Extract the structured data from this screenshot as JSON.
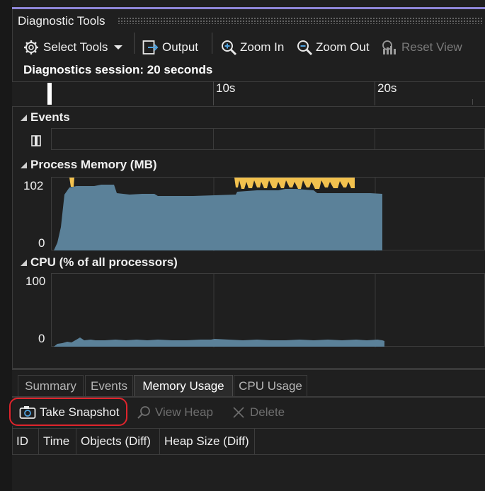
{
  "window": {
    "title": "Diagnostic Tools"
  },
  "toolbar": {
    "select_tools": "Select Tools",
    "output": "Output",
    "zoom_in": "Zoom In",
    "zoom_out": "Zoom Out",
    "reset_view": "Reset View"
  },
  "session": {
    "text": "Diagnostics session: 20 seconds"
  },
  "ruler": {
    "ticks": [
      "10s",
      "20s"
    ]
  },
  "sections": {
    "events": "Events",
    "memory": "Process Memory (MB)",
    "cpu": "CPU (% of all processors)"
  },
  "memory_chart": {
    "y_max_label": "102",
    "y_min_label": "0",
    "fill_color": "#5b8199",
    "gc_color": "#f2c14e"
  },
  "cpu_chart": {
    "y_max_label": "100",
    "y_min_label": "0",
    "fill_color": "#5b8199"
  },
  "tabs": [
    "Summary",
    "Events",
    "Memory Usage",
    "CPU Usage"
  ],
  "active_tab": "Memory Usage",
  "memory_toolbar": {
    "take_snapshot": "Take Snapshot",
    "view_heap": "View Heap",
    "delete": "Delete"
  },
  "table": {
    "columns": [
      "ID",
      "Time",
      "Objects (Diff)",
      "Heap Size (Diff)"
    ]
  },
  "colors": {
    "highlight": "#e0242c",
    "accent": "#8e86d8"
  }
}
